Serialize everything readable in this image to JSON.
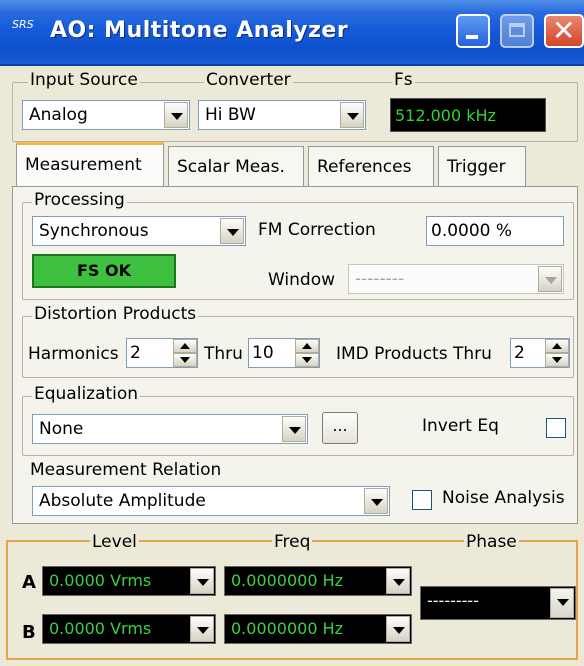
{
  "window": {
    "title": "AO: Multitone Analyzer",
    "logo": "SRS"
  },
  "top": {
    "input_source_label": "Input Source",
    "input_source_value": "Analog",
    "converter_label": "Converter",
    "converter_value": "Hi BW",
    "fs_label": "Fs",
    "fs_value": "512.000 kHz"
  },
  "tabs": [
    "Measurement",
    "Scalar Meas.",
    "References",
    "Trigger"
  ],
  "processing": {
    "label": "Processing",
    "mode_value": "Synchronous",
    "fm_correction_label": "FM Correction",
    "fm_correction_value": "0.0000 %",
    "status": "FS OK",
    "window_label": "Window",
    "window_value": "--------"
  },
  "distortion": {
    "label": "Distortion Products",
    "harmonics_label": "Harmonics",
    "harmonics_value": "2",
    "thru_label": "Thru",
    "thru_value": "10",
    "imd_label": "IMD Products Thru",
    "imd_value": "2"
  },
  "equalization": {
    "label": "Equalization",
    "value": "None",
    "browse_label": "...",
    "invert_label": "Invert Eq"
  },
  "relation": {
    "label": "Measurement Relation",
    "value": "Absolute Amplitude",
    "noise_label": "Noise Analysis"
  },
  "readouts": {
    "level_label": "Level",
    "freq_label": "Freq",
    "phase_label": "Phase",
    "rows": [
      {
        "channel": "A",
        "level": "0.0000 Vrms",
        "freq": "0.0000000 Hz"
      },
      {
        "channel": "B",
        "level": "0.0000 Vrms",
        "freq": "0.0000000 Hz"
      }
    ],
    "phase_value": "---------"
  },
  "colors": {
    "titlebar": "#155bd8",
    "accent_orange": "#e3a44a",
    "status_green": "#40c040",
    "readout_text": "#3cd23c"
  }
}
